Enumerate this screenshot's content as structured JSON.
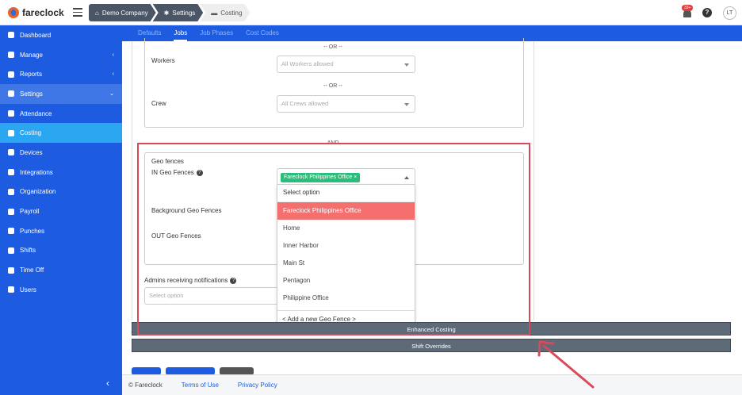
{
  "app": {
    "brand": "fareclock"
  },
  "breadcrumbs": [
    "Demo Company",
    "Settings",
    "Costing"
  ],
  "topbar": {
    "notification_count": "33+",
    "help": "?",
    "user_initials": "LT"
  },
  "sidebar": {
    "items": [
      {
        "label": "Dashboard",
        "icon": "dashboard-icon"
      },
      {
        "label": "Manage",
        "icon": "person-icon",
        "chevron": "‹"
      },
      {
        "label": "Reports",
        "icon": "chart-icon",
        "chevron": "‹"
      },
      {
        "label": "Settings",
        "icon": "gear-icon",
        "chevron": "⌄"
      },
      {
        "label": "Attendance",
        "icon": "attendance-icon"
      },
      {
        "label": "Costing",
        "icon": "folder-icon"
      },
      {
        "label": "Devices",
        "icon": "device-icon"
      },
      {
        "label": "Integrations",
        "icon": "plug-icon"
      },
      {
        "label": "Organization",
        "icon": "org-icon"
      },
      {
        "label": "Payroll",
        "icon": "payroll-icon"
      },
      {
        "label": "Punches",
        "icon": "punch-icon"
      },
      {
        "label": "Shifts",
        "icon": "shifts-icon"
      },
      {
        "label": "Time Off",
        "icon": "timeoff-icon"
      },
      {
        "label": "Users",
        "icon": "users-icon"
      }
    ],
    "collapse": "‹"
  },
  "tabs": [
    "Defaults",
    "Jobs",
    "Job Phases",
    "Cost Codes"
  ],
  "form": {
    "or_top": "-- OR --",
    "workers_label": "Workers",
    "workers_placeholder": "All Workers allowed",
    "or_mid": "-- OR --",
    "crew_label": "Crew",
    "crew_placeholder": "All Crews allowed",
    "and": "AND",
    "geo_title": "Geo fences",
    "in_geo_label": "IN Geo Fences",
    "background_geo_label": "Background Geo Fences",
    "out_geo_label": "OUT Geo Fences",
    "selected_chip": "Fareclock Philippines Office",
    "chip_remove": "×",
    "admins_label": "Admins receiving notifications",
    "admins_placeholder": "Select option"
  },
  "dropdown": {
    "header": "Select option",
    "options": [
      "Fareclock Philippines Office",
      "Home",
      "Inner Harbor",
      "Main St",
      "Pentagon",
      "Philippine Office"
    ],
    "add_new": "< Add a new Geo Fence >"
  },
  "sections": {
    "enhanced_costing": "Enhanced Costing",
    "shift_overrides": "Shift Overrides"
  },
  "footer": {
    "copyright": "© Fareclock",
    "terms": "Terms of Use",
    "privacy": "Privacy Policy"
  },
  "colors": {
    "sidebar": "#1d5ce0",
    "active_item": "#2aa7f0",
    "highlight": "#f66f6f",
    "chip": "#2dbd7a",
    "annotation": "#d84a5a"
  }
}
